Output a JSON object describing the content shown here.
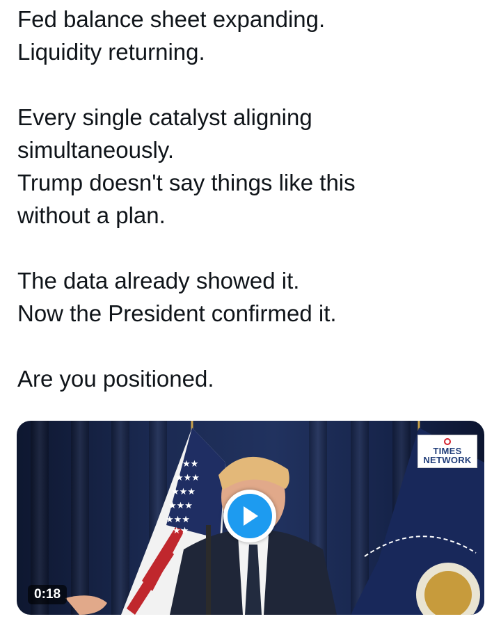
{
  "tweet": {
    "lines": [
      "Fed balance sheet expanding.",
      "Liquidity returning.",
      "",
      "Every single catalyst aligning",
      "simultaneously.",
      "Trump doesn't say things like this",
      "without a plan.",
      "",
      "The data already showed it.",
      "Now the President confirmed it.",
      "",
      "Are you positioned."
    ]
  },
  "media": {
    "duration": "0:18",
    "logo_line1": "TIMES",
    "logo_line2": "NETWORK",
    "colors": {
      "play_button": "#1d9bf0",
      "curtain": "#1b2a52"
    },
    "icons": [
      "play-icon"
    ]
  }
}
